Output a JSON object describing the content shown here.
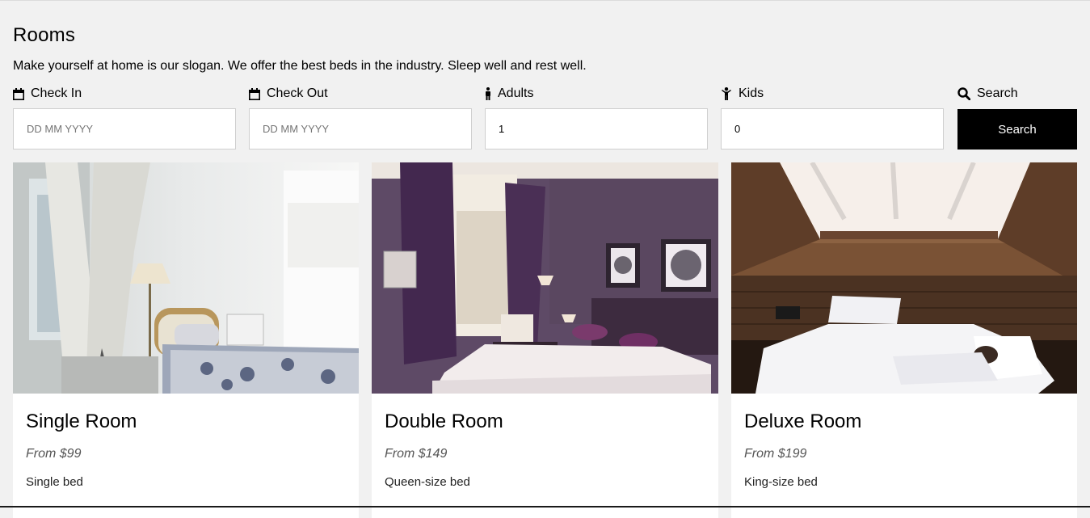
{
  "page": {
    "title": "Rooms",
    "slogan": "Make yourself at home is our slogan. We offer the best beds in the industry. Sleep well and rest well."
  },
  "filters": {
    "check_in": {
      "label": "Check In",
      "placeholder": "DD MM YYYY",
      "icon": "calendar-icon"
    },
    "check_out": {
      "label": "Check Out",
      "placeholder": "DD MM YYYY",
      "icon": "calendar-icon"
    },
    "adults": {
      "label": "Adults",
      "value": "1",
      "icon": "person-icon"
    },
    "kids": {
      "label": "Kids",
      "value": "0",
      "icon": "child-icon"
    },
    "search": {
      "label": "Search",
      "button_label": "Search",
      "icon": "search-icon"
    }
  },
  "rooms": [
    {
      "name": "Single Room",
      "price": "From $99",
      "bed": "Single bed"
    },
    {
      "name": "Double Room",
      "price": "From $149",
      "bed": "Queen-size bed"
    },
    {
      "name": "Deluxe Room",
      "price": "From $199",
      "bed": "King-size bed"
    }
  ],
  "colors": {
    "background": "#f1f1f1",
    "button": "#000000",
    "card": "#ffffff"
  }
}
